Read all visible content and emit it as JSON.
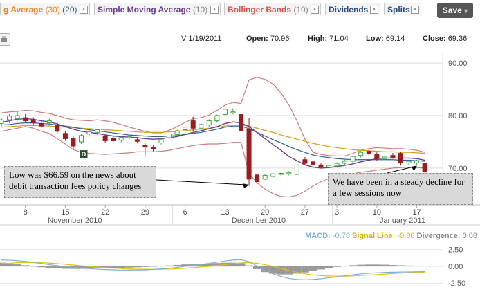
{
  "toolbar": {
    "chips": [
      {
        "label": "g Average",
        "param": "(30)",
        "param2": "(20)",
        "color": "#e08a1e"
      },
      {
        "label": "Simple Moving Average",
        "param": "(10)",
        "color": "#6a3d8f"
      },
      {
        "label": "Bollinger Bands",
        "param": "(10)",
        "color": "#d9534f"
      },
      {
        "label": "Dividends",
        "param": "",
        "color": "#2c4a7c"
      },
      {
        "label": "Splits",
        "param": "",
        "color": "#2c4a7c"
      }
    ],
    "close_glyph": "×",
    "save_label": "Save",
    "save_arrow": "▾"
  },
  "info": {
    "symbol_date": "V 1/19/2011",
    "open_label": "Open:",
    "open": "70.96",
    "high_label": "High:",
    "high": "71.04",
    "low_label": "Low:",
    "low": "69.14",
    "close_label": "Close:",
    "close": "69.36"
  },
  "annotations": {
    "low_note": "Low was $66.59 on the news about debit transaction fees policy changes",
    "decline_note": "We have been in a steady decline for a few sessions now",
    "dividend_marker": "D"
  },
  "macd_legend": {
    "macd_label": "MACD:",
    "macd": "-0.78",
    "signal_label": "Signal Line:",
    "signal": "-0.86",
    "divergence_label": "Divergence:",
    "divergence": "0.08"
  },
  "colors": {
    "up": "#3aa63a",
    "down": "#9b1c1c",
    "bollinger": "#d27a7a",
    "sma10": "#6a3d8f",
    "ma30": "#d4a017",
    "ma20": "#2d5f9a",
    "macd_line": "#7fb0d8",
    "signal_line": "#e6c200",
    "divergence": "#999999"
  },
  "chart_data": [
    {
      "type": "candlestick",
      "ylim": [
        63,
        92
      ],
      "y_ticks": [
        {
          "value": 90,
          "label": "90.00"
        },
        {
          "value": 80,
          "label": "80.00"
        },
        {
          "value": 70,
          "label": "70.00"
        }
      ],
      "x_ticks": [
        {
          "i": 3,
          "label": "8"
        },
        {
          "i": 8,
          "label": "15"
        },
        {
          "i": 13,
          "label": "22"
        },
        {
          "i": 18,
          "label": "29"
        },
        {
          "i": 23,
          "label": "6"
        },
        {
          "i": 28,
          "label": "13"
        },
        {
          "i": 33,
          "label": "20"
        },
        {
          "i": 38,
          "label": "27"
        },
        {
          "i": 42,
          "label": "3"
        },
        {
          "i": 47,
          "label": "10"
        },
        {
          "i": 52,
          "label": "17"
        }
      ],
      "months": [
        {
          "i": 8,
          "label": "November 2010"
        },
        {
          "i": 31,
          "label": "December 2010"
        },
        {
          "i": 49,
          "label": "January 2011"
        }
      ],
      "candles": [
        {
          "o": 78.5,
          "h": 79.6,
          "l": 77.8,
          "c": 79.2
        },
        {
          "o": 79.2,
          "h": 80.3,
          "l": 78.6,
          "c": 79.9
        },
        {
          "o": 79.4,
          "h": 80.8,
          "l": 79.0,
          "c": 80.0
        },
        {
          "o": 79.6,
          "h": 80.3,
          "l": 78.7,
          "c": 79.0
        },
        {
          "o": 79.2,
          "h": 79.7,
          "l": 78.3,
          "c": 78.6
        },
        {
          "o": 78.5,
          "h": 79.0,
          "l": 77.6,
          "c": 78.0
        },
        {
          "o": 78.6,
          "h": 79.4,
          "l": 78.1,
          "c": 79.0
        },
        {
          "o": 78.2,
          "h": 78.7,
          "l": 76.6,
          "c": 77.0
        },
        {
          "o": 76.6,
          "h": 77.1,
          "l": 75.2,
          "c": 75.6
        },
        {
          "o": 75.6,
          "h": 76.1,
          "l": 73.6,
          "c": 74.2
        },
        {
          "o": 75.0,
          "h": 76.5,
          "l": 74.6,
          "c": 76.2
        },
        {
          "o": 76.5,
          "h": 77.2,
          "l": 76.0,
          "c": 76.9
        },
        {
          "o": 76.8,
          "h": 77.5,
          "l": 76.3,
          "c": 77.3
        },
        {
          "o": 76.0,
          "h": 76.5,
          "l": 74.8,
          "c": 75.2
        },
        {
          "o": 75.6,
          "h": 76.1,
          "l": 74.9,
          "c": 75.2
        },
        {
          "o": 75.3,
          "h": 76.0,
          "l": 74.9,
          "c": 75.8
        },
        {
          "o": 75.8,
          "h": 76.4,
          "l": 75.4,
          "c": 76.0
        },
        {
          "o": 75.4,
          "h": 75.9,
          "l": 74.7,
          "c": 75.1
        },
        {
          "o": 74.4,
          "h": 74.8,
          "l": 72.3,
          "c": 74.0
        },
        {
          "o": 74.0,
          "h": 74.4,
          "l": 73.2,
          "c": 73.7
        },
        {
          "o": 74.8,
          "h": 75.8,
          "l": 74.5,
          "c": 75.5
        },
        {
          "o": 75.8,
          "h": 76.8,
          "l": 75.4,
          "c": 76.5
        },
        {
          "o": 76.4,
          "h": 77.3,
          "l": 76.0,
          "c": 77.1
        },
        {
          "o": 77.3,
          "h": 78.1,
          "l": 76.9,
          "c": 77.8
        },
        {
          "o": 79.0,
          "h": 79.8,
          "l": 77.1,
          "c": 77.6
        },
        {
          "o": 77.6,
          "h": 78.5,
          "l": 77.2,
          "c": 78.3
        },
        {
          "o": 78.2,
          "h": 79.3,
          "l": 77.8,
          "c": 79.0
        },
        {
          "o": 79.0,
          "h": 80.2,
          "l": 78.6,
          "c": 80.0
        },
        {
          "o": 80.2,
          "h": 81.3,
          "l": 79.7,
          "c": 81.2
        },
        {
          "o": 80.6,
          "h": 81.4,
          "l": 80.2,
          "c": 80.7
        },
        {
          "o": 80.2,
          "h": 80.6,
          "l": 76.6,
          "c": 77.1
        },
        {
          "o": 77.4,
          "h": 79.6,
          "l": 66.59,
          "c": 67.9
        },
        {
          "o": 68.7,
          "h": 69.1,
          "l": 67.2,
          "c": 67.4
        },
        {
          "o": 67.9,
          "h": 68.9,
          "l": 67.7,
          "c": 68.6
        },
        {
          "o": 68.4,
          "h": 69.2,
          "l": 68.2,
          "c": 68.9
        },
        {
          "o": 68.8,
          "h": 69.4,
          "l": 68.6,
          "c": 69.0
        },
        {
          "o": 68.9,
          "h": 69.4,
          "l": 68.6,
          "c": 69.1
        },
        {
          "o": 68.8,
          "h": 70.8,
          "l": 68.6,
          "c": 70.6
        },
        {
          "o": 71.6,
          "h": 72.1,
          "l": 70.6,
          "c": 70.9
        },
        {
          "o": 71.2,
          "h": 71.6,
          "l": 70.4,
          "c": 70.6
        },
        {
          "o": 70.6,
          "h": 71.0,
          "l": 69.9,
          "c": 70.2
        },
        {
          "o": 70.2,
          "h": 70.8,
          "l": 69.9,
          "c": 70.5
        },
        {
          "o": 70.4,
          "h": 71.1,
          "l": 70.1,
          "c": 70.9
        },
        {
          "o": 70.9,
          "h": 71.6,
          "l": 70.6,
          "c": 71.3
        },
        {
          "o": 71.3,
          "h": 72.4,
          "l": 71.0,
          "c": 72.2
        },
        {
          "o": 72.4,
          "h": 73.3,
          "l": 72.0,
          "c": 73.0
        },
        {
          "o": 73.2,
          "h": 73.5,
          "l": 72.4,
          "c": 72.7
        },
        {
          "o": 72.6,
          "h": 73.0,
          "l": 71.4,
          "c": 71.8
        },
        {
          "o": 71.8,
          "h": 72.4,
          "l": 71.5,
          "c": 72.1
        },
        {
          "o": 72.4,
          "h": 72.9,
          "l": 71.8,
          "c": 72.0
        },
        {
          "o": 72.8,
          "h": 73.0,
          "l": 70.5,
          "c": 71.1
        },
        {
          "o": 71.0,
          "h": 71.5,
          "l": 70.6,
          "c": 71.3
        },
        {
          "o": 71.0,
          "h": 71.6,
          "l": 70.6,
          "c": 71.4
        },
        {
          "o": 70.96,
          "h": 71.04,
          "l": 69.14,
          "c": 69.36
        }
      ],
      "series": [
        {
          "key": "bb_upper",
          "values": [
            80.5,
            80.7,
            80.8,
            81.0,
            80.9,
            80.6,
            80.4,
            80.0,
            79.5,
            79.2,
            79.1,
            79.0,
            79.2,
            79.0,
            78.7,
            78.3,
            77.8,
            77.4,
            77.0,
            76.7,
            76.7,
            77.2,
            77.9,
            78.7,
            79.4,
            79.6,
            80.1,
            81.0,
            82.0,
            82.5,
            82.3,
            86.8,
            87.3,
            86.9,
            86.0,
            84.3,
            82.0,
            79.0,
            75.5,
            73.0,
            72.6,
            72.4,
            72.3,
            72.3,
            72.8,
            73.4,
            73.7,
            73.9,
            73.8,
            73.7,
            73.7,
            73.6,
            73.4,
            73.0
          ]
        },
        {
          "key": "bb_lower",
          "values": [
            77.0,
            77.3,
            77.6,
            77.9,
            77.6,
            77.0,
            76.6,
            75.6,
            74.6,
            73.5,
            73.0,
            72.8,
            72.7,
            72.6,
            72.7,
            72.8,
            72.9,
            73.1,
            73.1,
            73.1,
            73.2,
            73.4,
            73.7,
            74.0,
            74.3,
            74.5,
            74.6,
            74.6,
            74.7,
            74.9,
            74.9,
            69.0,
            67.2,
            66.0,
            65.1,
            64.6,
            64.5,
            64.8,
            65.6,
            66.6,
            67.4,
            68.0,
            68.4,
            68.7,
            68.9,
            69.2,
            69.4,
            69.6,
            69.8,
            70.0,
            70.1,
            70.2,
            70.1,
            70.0
          ]
        },
        {
          "key": "sma10",
          "values": [
            78.7,
            79.0,
            79.3,
            79.4,
            79.3,
            79.0,
            78.8,
            78.4,
            77.9,
            77.4,
            77.0,
            76.8,
            76.6,
            76.3,
            76.1,
            76.0,
            75.9,
            75.8,
            75.6,
            75.5,
            75.6,
            75.8,
            76.0,
            76.4,
            76.8,
            77.1,
            77.5,
            77.9,
            78.5,
            78.8,
            78.6,
            77.9,
            76.8,
            75.6,
            74.5,
            73.4,
            72.2,
            71.4,
            70.6,
            70.2,
            70.0,
            70.1,
            70.3,
            70.5,
            70.8,
            71.2,
            71.5,
            71.8,
            71.9,
            71.9,
            71.9,
            71.9,
            71.8,
            71.5
          ]
        },
        {
          "key": "ma30",
          "values": [
            77.8,
            77.9,
            78.0,
            78.1,
            78.1,
            78.1,
            78.0,
            77.9,
            77.8,
            77.7,
            77.6,
            77.5,
            77.4,
            77.3,
            77.2,
            77.1,
            77.0,
            76.9,
            76.8,
            76.8,
            76.8,
            76.9,
            77.0,
            77.1,
            77.3,
            77.4,
            77.6,
            77.8,
            78.0,
            78.2,
            78.2,
            78.0,
            77.6,
            77.2,
            76.8,
            76.3,
            75.9,
            75.5,
            75.1,
            74.7,
            74.4,
            74.1,
            73.9,
            73.7,
            73.5,
            73.4,
            73.3,
            73.2,
            73.1,
            73.1,
            73.0,
            73.0,
            72.9,
            72.8
          ]
        },
        {
          "key": "ma20",
          "values": [
            78.2,
            78.3,
            78.5,
            78.6,
            78.6,
            78.5,
            78.4,
            78.2,
            78.0,
            77.8,
            77.5,
            77.3,
            77.1,
            76.9,
            76.7,
            76.5,
            76.3,
            76.2,
            76.1,
            76.0,
            76.0,
            76.1,
            76.2,
            76.4,
            76.6,
            76.8,
            77.1,
            77.4,
            77.8,
            78.0,
            78.0,
            77.5,
            76.8,
            76.1,
            75.4,
            74.8,
            74.1,
            73.5,
            73.0,
            72.5,
            72.2,
            72.0,
            71.8,
            71.7,
            71.6,
            71.6,
            71.6,
            71.6,
            71.6,
            71.6,
            71.5,
            71.5,
            71.4,
            71.3
          ]
        }
      ]
    },
    {
      "type": "line",
      "ylim": [
        -3.2,
        3.4
      ],
      "y_ticks": [
        {
          "value": 2.5,
          "label": "2.50"
        },
        {
          "value": 0,
          "label": "0.00"
        },
        {
          "value": -2.5,
          "label": "-2.50"
        }
      ],
      "series": [
        {
          "key": "macd",
          "values": [
            0.95,
            0.92,
            0.85,
            0.75,
            0.6,
            0.42,
            0.25,
            0.1,
            -0.05,
            -0.18,
            -0.28,
            -0.35,
            -0.42,
            -0.48,
            -0.52,
            -0.55,
            -0.56,
            -0.55,
            -0.52,
            -0.46,
            -0.38,
            -0.28,
            -0.15,
            0.0,
            0.15,
            0.3,
            0.45,
            0.62,
            0.8,
            0.95,
            1.0,
            0.7,
            0.05,
            -0.6,
            -1.1,
            -1.5,
            -1.8,
            -1.95,
            -2.0,
            -1.95,
            -1.85,
            -1.7,
            -1.55,
            -1.4,
            -1.25,
            -1.12,
            -1.02,
            -0.95,
            -0.9,
            -0.87,
            -0.85,
            -0.83,
            -0.8,
            -0.78
          ]
        },
        {
          "key": "signal",
          "values": [
            0.4,
            0.48,
            0.55,
            0.58,
            0.58,
            0.55,
            0.49,
            0.41,
            0.31,
            0.2,
            0.09,
            -0.02,
            -0.12,
            -0.2,
            -0.27,
            -0.33,
            -0.38,
            -0.41,
            -0.43,
            -0.44,
            -0.43,
            -0.41,
            -0.36,
            -0.29,
            -0.2,
            -0.1,
            0.01,
            0.13,
            0.26,
            0.4,
            0.52,
            0.56,
            0.46,
            0.25,
            0.0,
            -0.3,
            -0.6,
            -0.87,
            -1.1,
            -1.27,
            -1.39,
            -1.45,
            -1.47,
            -1.46,
            -1.42,
            -1.36,
            -1.29,
            -1.22,
            -1.15,
            -1.07,
            -1.0,
            -0.95,
            -0.9,
            -0.86
          ]
        },
        {
          "key": "divergence",
          "values": [
            0.55,
            0.44,
            0.3,
            0.17,
            0.02,
            -0.13,
            -0.24,
            -0.31,
            -0.36,
            -0.38,
            -0.37,
            -0.33,
            -0.3,
            -0.28,
            -0.25,
            -0.22,
            -0.18,
            -0.14,
            -0.09,
            -0.02,
            0.05,
            0.13,
            0.21,
            0.29,
            0.35,
            0.4,
            0.44,
            0.49,
            0.54,
            0.55,
            0.48,
            0.14,
            -0.41,
            -0.85,
            -1.1,
            -1.2,
            -1.2,
            -1.08,
            -0.9,
            -0.68,
            -0.46,
            -0.25,
            -0.08,
            0.06,
            0.17,
            0.24,
            0.27,
            0.27,
            0.25,
            0.2,
            0.15,
            0.12,
            0.1,
            0.08
          ]
        }
      ]
    }
  ]
}
